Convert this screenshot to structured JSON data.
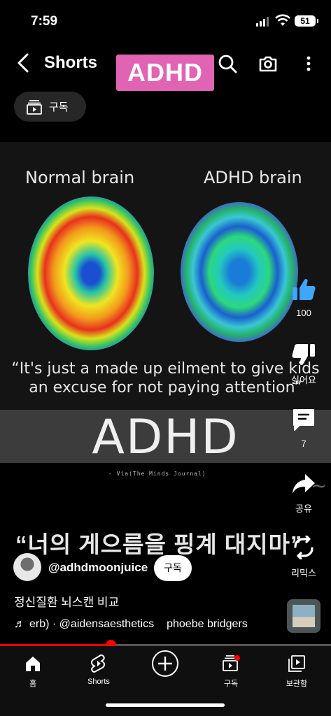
{
  "status_bar": {
    "time": "7:59",
    "battery": "51"
  },
  "header": {
    "title": "Shorts",
    "overlay_badge": "ADHD"
  },
  "subscriptions_pill": {
    "label": "구독"
  },
  "video": {
    "left_label": "Normal brain",
    "right_label": "ADHD brain",
    "quote_line1": "“It's just a made up eilment to give kids",
    "quote_line2": "an excuse for not paying attention”",
    "big_text": "ADHD",
    "credit": "- Via(The Minds Journal)"
  },
  "caption": "“너의 게으름을 핑계 대지마”",
  "actions": {
    "like_count": "100",
    "dislike_label": "싫어요",
    "comment_count": "7",
    "share_label": "공유",
    "remix_label": "리믹스"
  },
  "channel": {
    "handle": "@adhdmoonjuice",
    "subscribe_label": "구독"
  },
  "description": "정신질환 뇌스캔 비교",
  "music": {
    "track": "erb) · @aidensaesthetics",
    "artist": "phoebe bridgers"
  },
  "progress": {
    "fraction": 0.335
  },
  "nav": {
    "home": "홈",
    "shorts": "Shorts",
    "subscriptions": "구독",
    "library": "보관함"
  },
  "colors": {
    "accent": "#ff0000",
    "badge": "#e064b3"
  }
}
